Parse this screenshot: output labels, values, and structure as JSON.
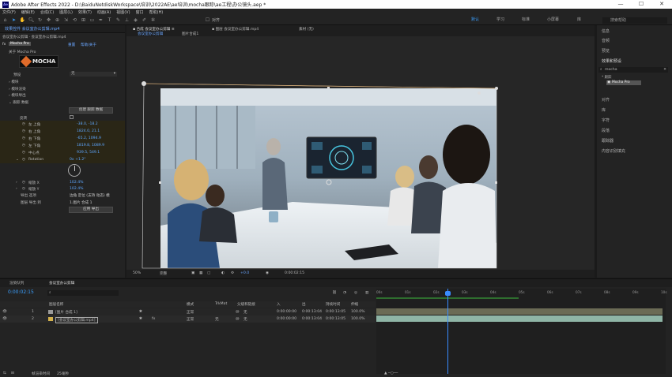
{
  "app": {
    "title": "Adobe After Effects 2022 - D:\\BaiduNetdiskWorkspace\\培训\\2022AE\\ae培训\\mocha跟踪\\ae工程\\办公镜头.aep *",
    "logo": "Ae"
  },
  "window_controls": {
    "minimize": "—",
    "maximize": "☐",
    "close": "✕"
  },
  "menu": [
    "文件(F)",
    "编辑(E)",
    "合成(C)",
    "图层(L)",
    "效果(T)",
    "动画(A)",
    "视图(V)",
    "窗口",
    "帮助(H)"
  ],
  "toolbar": {
    "snap_label": "对齐",
    "workspaces": [
      "默认",
      "学习",
      "标准",
      "小屏幕",
      "库"
    ],
    "search_placeholder": "搜索帮助"
  },
  "effects_panel": {
    "tab": "效果控件 会议室办公剪辑.mp4",
    "breadcrumb": "会议室办公剪辑 · 会议室办公剪辑.mp4",
    "effect_name": "Mocha Pro",
    "fx_badge": "fx",
    "effect_sub": "关于 Mocha Pro",
    "reset_label": "重置",
    "about_label": "帮助/关于",
    "logo_text": "MOCHA",
    "preset_label": "预设",
    "preset_value": "无",
    "sections": [
      "模块",
      "模块渲染",
      "模块导出",
      "跟踪 数据"
    ],
    "create_data_btn": "创建 跟踪 数据",
    "invert_label": "反转",
    "track_rows": [
      {
        "label": "左 上角",
        "value": "-38.0, -18.2"
      },
      {
        "label": "右 上角",
        "value": "1824.0, 21.1"
      },
      {
        "label": "右 下角",
        "value": "-65.2, 1094.9"
      },
      {
        "label": "左 下角",
        "value": "1819.8, 1089.9"
      },
      {
        "label": "中心点",
        "value": "939.5, 549.1"
      }
    ],
    "rotation": {
      "label": "Rotation",
      "value": "0x +1.2°"
    },
    "scale_rows": [
      {
        "label": "缩放 X",
        "value": "102.4%"
      },
      {
        "label": "缩放 Y",
        "value": "102.4%"
      }
    ],
    "export_label": "导出 选项",
    "export_value": "边角 定位 (支持 动态) 模",
    "layer_label": "图层 导出 到",
    "layer_value": "1.图片 合成 1",
    "apply_btn": "应用 导出"
  },
  "comp_panel": {
    "tab": "合成 会议室办公剪辑",
    "layer_tab": "图层 会议室办公剪辑.mp4",
    "footage_tab": "素材 (无)",
    "crumbs": [
      "会议室办公剪辑",
      "图片合成1"
    ],
    "zoom": "50%",
    "quality": "完整",
    "timecode": "0:00:02:15",
    "exposure": "+0.0"
  },
  "right_panel": {
    "items_top": [
      "信息",
      "音频",
      "预览"
    ],
    "effects_title": "效果和预设",
    "effects_search": "mocha",
    "effects_group": "* 跟踪",
    "effects_result": "Mocha Pro",
    "items_bottom": [
      "对齐",
      "库",
      "字符",
      "段落",
      "跟踪器",
      "内容识别填充"
    ]
  },
  "timeline": {
    "tabs": [
      "渲染队列",
      "会议室办公剪辑"
    ],
    "timecode": "0:00:02:15",
    "search_placeholder": "",
    "columns": {
      "name": "图层名称",
      "mode": "模式",
      "trkmat": "TrkMat",
      "parent": "父级和链接",
      "in": "入",
      "out": "出",
      "duration": "持续时间",
      "stretch": "伸缩"
    },
    "layers": [
      {
        "num": "1",
        "name": "[图片 合成 1]",
        "mode": "正常",
        "trkmat": "",
        "parent": "无",
        "in": "0:00:00:00",
        "out": "0:00:13:04",
        "duration": "0:00:13:05",
        "stretch": "100.0%"
      },
      {
        "num": "2",
        "name": "[会议室办公剪辑.mp4]",
        "mode": "正常",
        "trkmat": "无",
        "parent": "无",
        "in": "0:00:00:00",
        "out": "0:00:13:04",
        "duration": "0:00:13:05",
        "stretch": "100.0%"
      }
    ],
    "ruler": [
      "00s",
      "01s",
      "02s",
      "03s",
      "04s",
      "05s",
      "06s",
      "07s",
      "08s",
      "09s",
      "10s"
    ],
    "playhead": 2.5,
    "footer_label": "帧渲染时间",
    "footer_value": "25毫秒"
  }
}
